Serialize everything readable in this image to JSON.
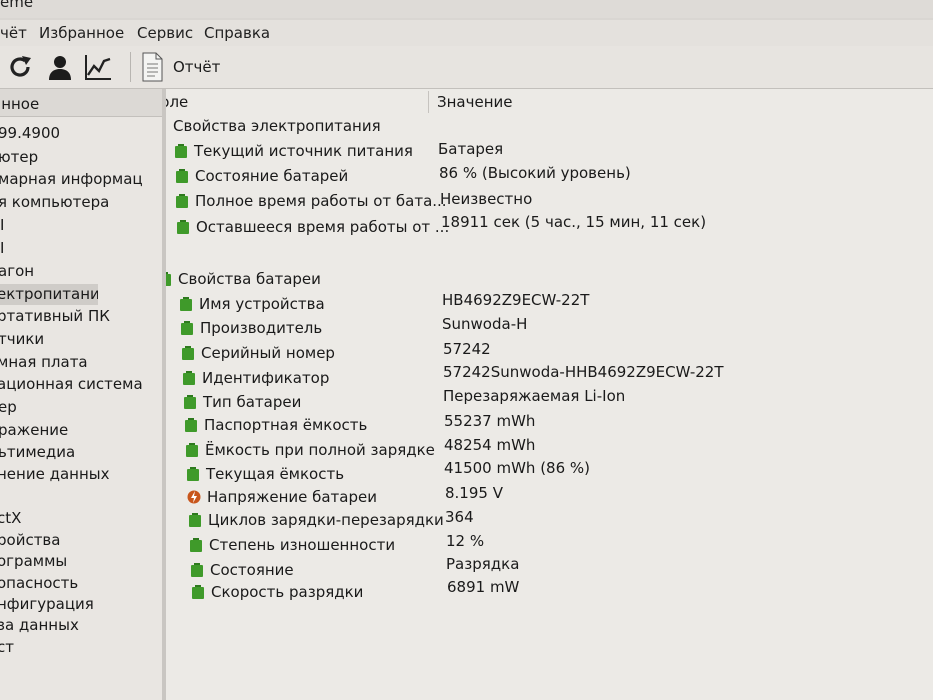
{
  "window": {
    "title_fragment": "eme"
  },
  "menu": {
    "items": [
      "чёт",
      "Избранное",
      "Сервис",
      "Справка"
    ]
  },
  "toolbar": {
    "report_label": "Отчёт",
    "icons": [
      "refresh-icon",
      "user-icon",
      "chart-line-icon",
      "report-icon"
    ]
  },
  "sidebar": {
    "header": "анное",
    "items": [
      "99.4900",
      "ютер",
      "марная информац",
      "я компьютера",
      "I",
      "I",
      "агон",
      "ектропитание",
      "ртативный ПК",
      "тчики",
      "мная плата",
      "ационная система",
      "ер",
      "ражение",
      "ьтимедиа",
      "нение данных",
      "",
      "ctX",
      "ройства",
      "ограммы",
      "опасность",
      "нфигурация",
      "за данных",
      "ст"
    ],
    "selected_index": 7
  },
  "table": {
    "col_field": "Поле",
    "col_value": "Значение",
    "groups": [
      {
        "title": "Свойства электропитания",
        "rows": [
          {
            "field": "Текущий источник питания",
            "value": "Батарея"
          },
          {
            "field": "Состояние батарей",
            "value": "86 % (Высокий уровень)"
          },
          {
            "field": "Полное время работы от бата...",
            "value": "Неизвестно"
          },
          {
            "field": "Оставшееся время работы от ...",
            "value": "18911 сек (5 час., 15 мин, 11 сек)"
          }
        ]
      },
      {
        "title": "Свойства батареи",
        "rows": [
          {
            "field": "Имя устройства",
            "value": "HB4692Z9ECW-22T"
          },
          {
            "field": "Производитель",
            "value": "Sunwoda-H"
          },
          {
            "field": "Серийный номер",
            "value": "57242"
          },
          {
            "field": "Идентификатор",
            "value": "57242Sunwoda-HHB4692Z9ECW-22T"
          },
          {
            "field": "Тип батареи",
            "value": "Перезаряжаемая Li-Ion"
          },
          {
            "field": "Паспортная ёмкость",
            "value": "55237 mWh"
          },
          {
            "field": "Ёмкость при полной зарядке",
            "value": "48254 mWh"
          },
          {
            "field": "Текущая ёмкость",
            "value": "41500 mWh  (86 %)"
          },
          {
            "field": "Напряжение батареи",
            "value": "8.195 V"
          },
          {
            "field": "Циклов зарядки-перезарядки",
            "value": "364"
          },
          {
            "field": "Степень изношенности",
            "value": "12 %"
          },
          {
            "field": "Состояние",
            "value": "Разрядка"
          },
          {
            "field": "Скорость разрядки",
            "value": "6891 mW"
          }
        ]
      }
    ]
  },
  "colors": {
    "battery_icon": "#3f9a2a",
    "voltage_icon": "#c8561c"
  }
}
